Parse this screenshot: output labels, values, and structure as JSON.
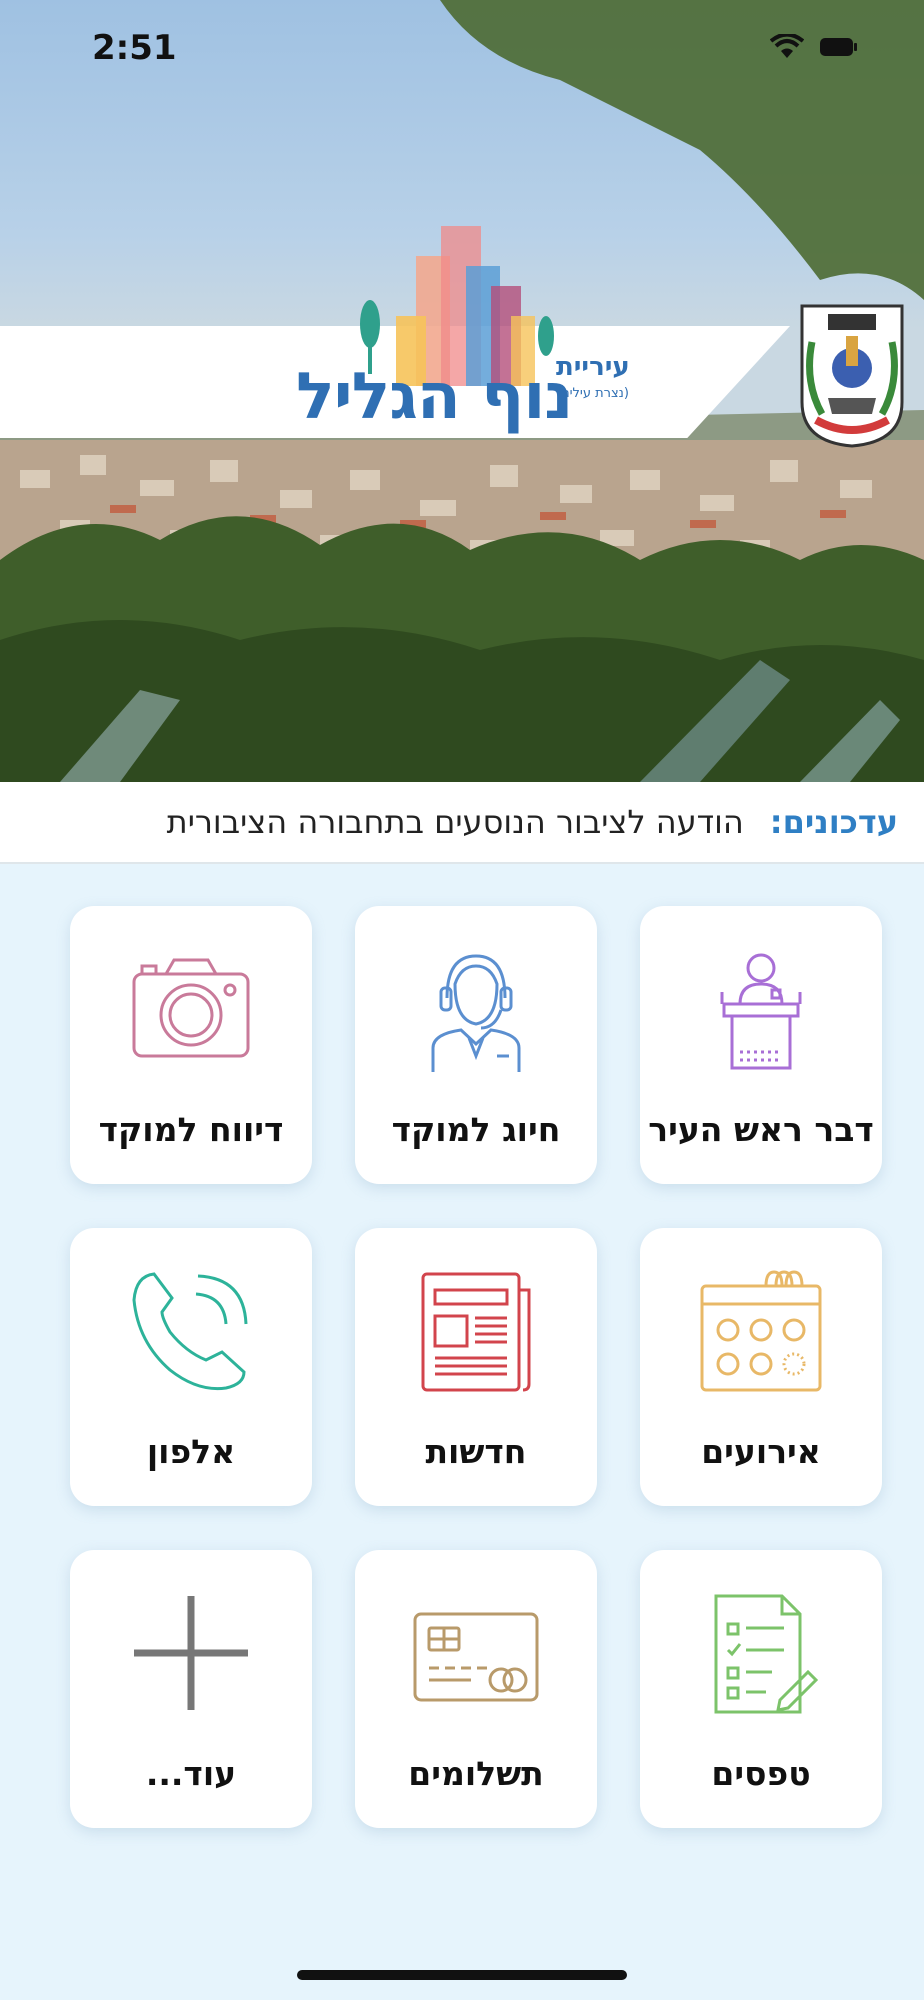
{
  "status_bar": {
    "time": "2:51"
  },
  "header": {
    "city_word": "עיריית",
    "old_name": "(נצרת עילית)",
    "city_name": "נוף הגליל",
    "crest_icon": "city-crest-icon"
  },
  "ticker": {
    "label": "עדכונים:",
    "text": "הודעה לציבור הנוסעים בתחבורה הציבורית"
  },
  "tiles": [
    {
      "label": "דבר ראש העיר",
      "icon": "mayor-podium-icon",
      "color": "#a86fd6"
    },
    {
      "label": "חיוג למוקד",
      "icon": "call-center-agent-icon",
      "color": "#5b8fd0"
    },
    {
      "label": "דיווח למוקד",
      "icon": "camera-icon",
      "color": "#c97a9a"
    },
    {
      "label": "אירועים",
      "icon": "calendar-icon",
      "color": "#e8b867"
    },
    {
      "label": "חדשות",
      "icon": "newspaper-icon",
      "color": "#d2444c"
    },
    {
      "label": "אלפון",
      "icon": "phone-icon",
      "color": "#2db39a"
    },
    {
      "label": "טפסים",
      "icon": "form-icon",
      "color": "#7cc36a"
    },
    {
      "label": "תשלומים",
      "icon": "credit-card-icon",
      "color": "#b89a6a"
    },
    {
      "label": "עוד...",
      "icon": "plus-icon",
      "color": "#777777"
    }
  ]
}
